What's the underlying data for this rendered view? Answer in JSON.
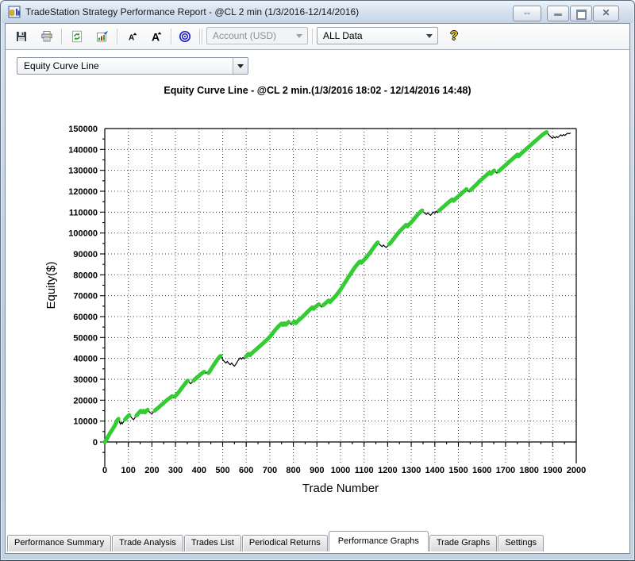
{
  "window": {
    "title": "TradeStation Strategy Performance Report - @CL 2 min (1/3/2016-12/14/2016)",
    "controls": {
      "link_glyph": "⇔",
      "close_glyph": "✕"
    }
  },
  "toolbar": {
    "icons": [
      "save-icon",
      "print-icon",
      "refresh-icon",
      "format-report-icon",
      "decrease-font-icon",
      "increase-font-icon",
      "target-icon",
      "help-icon"
    ],
    "account_dropdown": {
      "value": "Account (USD)",
      "disabled": true
    },
    "data_dropdown": {
      "value": "ALL Data",
      "disabled": false
    },
    "help_glyph": "?"
  },
  "graph_selector": {
    "value": "Equity Curve Line"
  },
  "tabs": [
    {
      "label": "Performance Summary",
      "active": false
    },
    {
      "label": "Trade Analysis",
      "active": false
    },
    {
      "label": "Trades List",
      "active": false
    },
    {
      "label": "Periodical Returns",
      "active": false
    },
    {
      "label": "Performance Graphs",
      "active": true
    },
    {
      "label": "Trade Graphs",
      "active": false
    },
    {
      "label": "Settings",
      "active": false
    }
  ],
  "chart_data": {
    "type": "line",
    "title": "Equity Curve Line - @CL 2 min.(1/3/2016 18:02 - 12/14/2016 14:48)",
    "xlabel": "Trade Number",
    "ylabel": "Equity($)",
    "xlim": [
      0,
      2000
    ],
    "ylim": [
      -10000,
      150000
    ],
    "x_ticks": [
      0,
      100,
      200,
      300,
      400,
      500,
      600,
      700,
      800,
      900,
      1000,
      1100,
      1200,
      1300,
      1400,
      1500,
      1600,
      1700,
      1800,
      1900,
      2000
    ],
    "y_ticks": [
      0,
      10000,
      20000,
      30000,
      40000,
      50000,
      60000,
      70000,
      80000,
      90000,
      100000,
      110000,
      120000,
      130000,
      140000,
      150000
    ],
    "x_minor_step": 50,
    "y_minor_step": 5000,
    "grid": true,
    "legend": false,
    "colors": {
      "new_high": "#33cc33",
      "drawdown": "#000000",
      "grid": "#404040",
      "axis": "#000000"
    },
    "series": [
      {
        "name": "Equity",
        "points": [
          [
            0,
            0
          ],
          [
            8,
            1200
          ],
          [
            15,
            2800
          ],
          [
            22,
            4200
          ],
          [
            28,
            5200
          ],
          [
            35,
            6500
          ],
          [
            42,
            7800
          ],
          [
            48,
            9200
          ],
          [
            53,
            10400
          ],
          [
            58,
            11000
          ],
          [
            62,
            9800
          ],
          [
            66,
            8600
          ],
          [
            70,
            9400
          ],
          [
            74,
            8700
          ],
          [
            80,
            9800
          ],
          [
            86,
            10800
          ],
          [
            92,
            11600
          ],
          [
            98,
            12300
          ],
          [
            104,
            12900
          ],
          [
            110,
            12200
          ],
          [
            116,
            11200
          ],
          [
            122,
            10700
          ],
          [
            128,
            11600
          ],
          [
            134,
            12600
          ],
          [
            140,
            13400
          ],
          [
            146,
            14200
          ],
          [
            152,
            14900
          ],
          [
            158,
            14200
          ],
          [
            164,
            14900
          ],
          [
            170,
            14100
          ],
          [
            176,
            14900
          ],
          [
            182,
            15400
          ],
          [
            188,
            14600
          ],
          [
            194,
            13900
          ],
          [
            200,
            13500
          ],
          [
            206,
            14300
          ],
          [
            212,
            15000
          ],
          [
            218,
            15600
          ],
          [
            224,
            16100
          ],
          [
            230,
            16700
          ],
          [
            238,
            17500
          ],
          [
            246,
            18300
          ],
          [
            254,
            19100
          ],
          [
            262,
            19900
          ],
          [
            270,
            20600
          ],
          [
            278,
            21300
          ],
          [
            286,
            21900
          ],
          [
            292,
            21100
          ],
          [
            298,
            21800
          ],
          [
            306,
            22800
          ],
          [
            314,
            23900
          ],
          [
            322,
            25100
          ],
          [
            330,
            26300
          ],
          [
            338,
            27500
          ],
          [
            346,
            28700
          ],
          [
            352,
            29400
          ],
          [
            358,
            28600
          ],
          [
            364,
            27900
          ],
          [
            370,
            28500
          ],
          [
            376,
            29300
          ],
          [
            382,
            30000
          ],
          [
            390,
            30800
          ],
          [
            398,
            31500
          ],
          [
            406,
            32300
          ],
          [
            414,
            33000
          ],
          [
            422,
            33600
          ],
          [
            428,
            32900
          ],
          [
            434,
            33400
          ],
          [
            440,
            33000
          ],
          [
            446,
            34000
          ],
          [
            454,
            35400
          ],
          [
            462,
            36800
          ],
          [
            470,
            38200
          ],
          [
            478,
            39500
          ],
          [
            486,
            40600
          ],
          [
            492,
            41200
          ],
          [
            497,
            40200
          ],
          [
            502,
            39200
          ],
          [
            508,
            38400
          ],
          [
            514,
            37800
          ],
          [
            520,
            38600
          ],
          [
            526,
            37600
          ],
          [
            532,
            37000
          ],
          [
            538,
            37800
          ],
          [
            544,
            36900
          ],
          [
            550,
            36300
          ],
          [
            556,
            37200
          ],
          [
            562,
            38300
          ],
          [
            568,
            39400
          ],
          [
            574,
            40300
          ],
          [
            580,
            39600
          ],
          [
            586,
            40400
          ],
          [
            592,
            39800
          ],
          [
            598,
            40800
          ],
          [
            604,
            41600
          ],
          [
            610,
            42200
          ],
          [
            616,
            41500
          ],
          [
            622,
            42300
          ],
          [
            630,
            43100
          ],
          [
            638,
            43900
          ],
          [
            646,
            44700
          ],
          [
            654,
            45500
          ],
          [
            662,
            46300
          ],
          [
            670,
            47100
          ],
          [
            678,
            47900
          ],
          [
            686,
            48700
          ],
          [
            694,
            49600
          ],
          [
            702,
            50600
          ],
          [
            710,
            51700
          ],
          [
            718,
            52900
          ],
          [
            726,
            54000
          ],
          [
            734,
            55000
          ],
          [
            742,
            55900
          ],
          [
            750,
            56700
          ],
          [
            756,
            56000
          ],
          [
            762,
            56800
          ],
          [
            768,
            56100
          ],
          [
            774,
            56900
          ],
          [
            780,
            57500
          ],
          [
            786,
            56800
          ],
          [
            792,
            56200
          ],
          [
            798,
            57000
          ],
          [
            804,
            57600
          ],
          [
            810,
            56900
          ],
          [
            816,
            57700
          ],
          [
            824,
            58400
          ],
          [
            832,
            59200
          ],
          [
            840,
            60000
          ],
          [
            848,
            60900
          ],
          [
            856,
            61800
          ],
          [
            864,
            62700
          ],
          [
            872,
            63600
          ],
          [
            880,
            64400
          ],
          [
            886,
            63700
          ],
          [
            892,
            64500
          ],
          [
            900,
            65200
          ],
          [
            908,
            65900
          ],
          [
            914,
            65200
          ],
          [
            920,
            64600
          ],
          [
            926,
            65400
          ],
          [
            934,
            66200
          ],
          [
            942,
            67000
          ],
          [
            950,
            67700
          ],
          [
            956,
            67000
          ],
          [
            962,
            67800
          ],
          [
            970,
            68700
          ],
          [
            978,
            69700
          ],
          [
            986,
            70800
          ],
          [
            994,
            72000
          ],
          [
            1002,
            73300
          ],
          [
            1010,
            74700
          ],
          [
            1018,
            76100
          ],
          [
            1026,
            77500
          ],
          [
            1034,
            79000
          ],
          [
            1042,
            80400
          ],
          [
            1050,
            81800
          ],
          [
            1058,
            83100
          ],
          [
            1066,
            84300
          ],
          [
            1074,
            85400
          ],
          [
            1082,
            86400
          ],
          [
            1088,
            85700
          ],
          [
            1094,
            86500
          ],
          [
            1102,
            87400
          ],
          [
            1110,
            88400
          ],
          [
            1118,
            89500
          ],
          [
            1126,
            90700
          ],
          [
            1134,
            92000
          ],
          [
            1142,
            93300
          ],
          [
            1150,
            94500
          ],
          [
            1158,
            95500
          ],
          [
            1164,
            94800
          ],
          [
            1170,
            94100
          ],
          [
            1176,
            93500
          ],
          [
            1182,
            94200
          ],
          [
            1188,
            93600
          ],
          [
            1194,
            93100
          ],
          [
            1200,
            93800
          ],
          [
            1206,
            94600
          ],
          [
            1214,
            95600
          ],
          [
            1222,
            96700
          ],
          [
            1230,
            97900
          ],
          [
            1238,
            99100
          ],
          [
            1246,
            100200
          ],
          [
            1254,
            101200
          ],
          [
            1262,
            102100
          ],
          [
            1270,
            103000
          ],
          [
            1278,
            103900
          ],
          [
            1284,
            103200
          ],
          [
            1290,
            104000
          ],
          [
            1298,
            104900
          ],
          [
            1306,
            105900
          ],
          [
            1314,
            107000
          ],
          [
            1322,
            108100
          ],
          [
            1330,
            109100
          ],
          [
            1338,
            110000
          ],
          [
            1346,
            110800
          ],
          [
            1352,
            110100
          ],
          [
            1358,
            109400
          ],
          [
            1364,
            108900
          ],
          [
            1370,
            109700
          ],
          [
            1376,
            109000
          ],
          [
            1382,
            108500
          ],
          [
            1388,
            109300
          ],
          [
            1394,
            110100
          ],
          [
            1400,
            109500
          ],
          [
            1406,
            110400
          ],
          [
            1412,
            109800
          ],
          [
            1418,
            110700
          ],
          [
            1426,
            111500
          ],
          [
            1434,
            112300
          ],
          [
            1442,
            113100
          ],
          [
            1450,
            113900
          ],
          [
            1458,
            114700
          ],
          [
            1466,
            115400
          ],
          [
            1474,
            116100
          ],
          [
            1480,
            115400
          ],
          [
            1486,
            116200
          ],
          [
            1494,
            117000
          ],
          [
            1502,
            117800
          ],
          [
            1510,
            118600
          ],
          [
            1518,
            119400
          ],
          [
            1526,
            120200
          ],
          [
            1534,
            121000
          ],
          [
            1540,
            120300
          ],
          [
            1546,
            119700
          ],
          [
            1552,
            120500
          ],
          [
            1560,
            121400
          ],
          [
            1568,
            122300
          ],
          [
            1576,
            123200
          ],
          [
            1584,
            124100
          ],
          [
            1592,
            125000
          ],
          [
            1600,
            125800
          ],
          [
            1608,
            126600
          ],
          [
            1616,
            127400
          ],
          [
            1624,
            128200
          ],
          [
            1632,
            129000
          ],
          [
            1638,
            128300
          ],
          [
            1644,
            129100
          ],
          [
            1652,
            129900
          ],
          [
            1658,
            129200
          ],
          [
            1664,
            128700
          ],
          [
            1670,
            129500
          ],
          [
            1678,
            130300
          ],
          [
            1686,
            131100
          ],
          [
            1694,
            131900
          ],
          [
            1702,
            132700
          ],
          [
            1710,
            133500
          ],
          [
            1718,
            134300
          ],
          [
            1726,
            135100
          ],
          [
            1734,
            135900
          ],
          [
            1742,
            136700
          ],
          [
            1750,
            137500
          ],
          [
            1756,
            136800
          ],
          [
            1762,
            137600
          ],
          [
            1770,
            138400
          ],
          [
            1778,
            139200
          ],
          [
            1786,
            140000
          ],
          [
            1794,
            140800
          ],
          [
            1802,
            141600
          ],
          [
            1810,
            142400
          ],
          [
            1818,
            143200
          ],
          [
            1826,
            144000
          ],
          [
            1834,
            144800
          ],
          [
            1842,
            145600
          ],
          [
            1850,
            146400
          ],
          [
            1858,
            147100
          ],
          [
            1866,
            147800
          ],
          [
            1874,
            148300
          ],
          [
            1880,
            147500
          ],
          [
            1886,
            146700
          ],
          [
            1892,
            146000
          ],
          [
            1898,
            145400
          ],
          [
            1904,
            146100
          ],
          [
            1910,
            145500
          ],
          [
            1916,
            146200
          ],
          [
            1922,
            145700
          ],
          [
            1928,
            146400
          ],
          [
            1934,
            147000
          ],
          [
            1940,
            146500
          ],
          [
            1946,
            147100
          ],
          [
            1952,
            146700
          ],
          [
            1958,
            147300
          ],
          [
            1964,
            147800
          ],
          [
            1970,
            147500
          ],
          [
            1976,
            147900
          ]
        ]
      }
    ]
  }
}
